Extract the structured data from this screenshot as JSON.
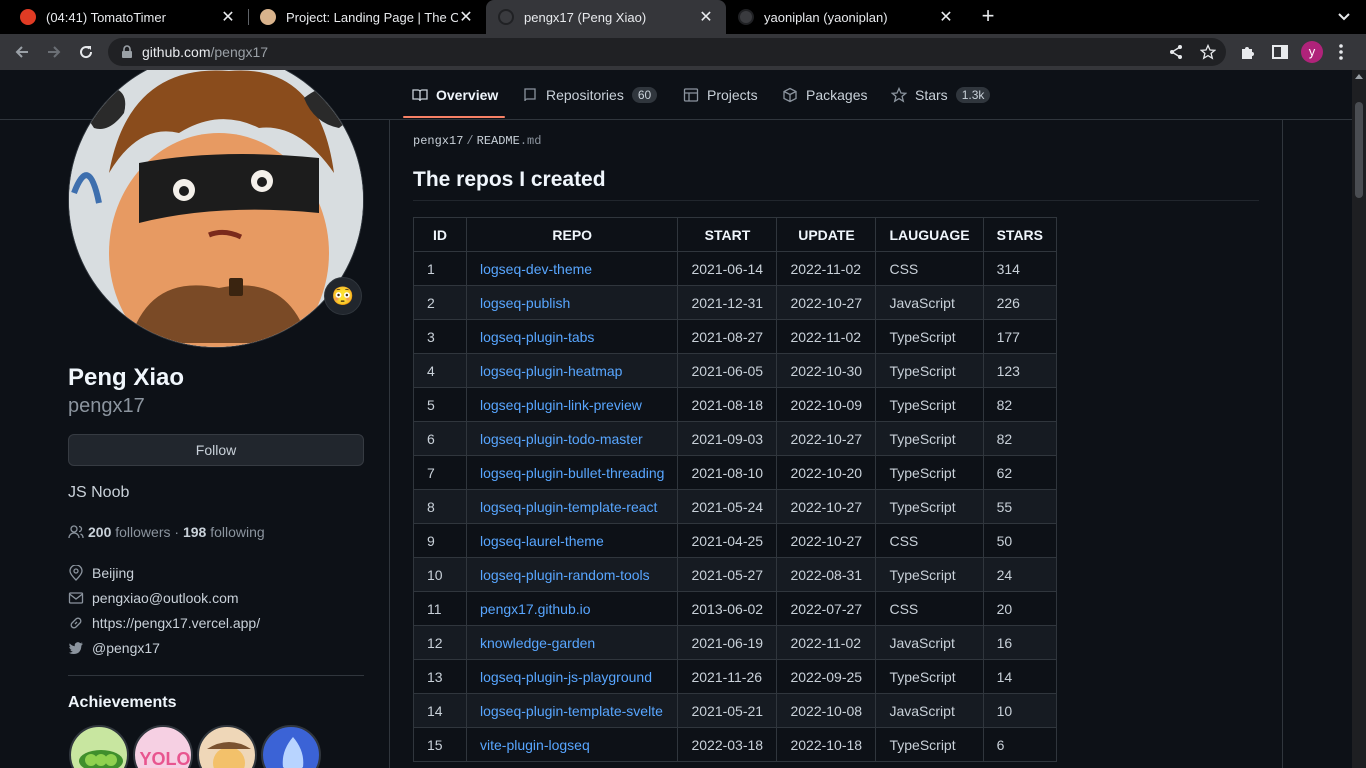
{
  "browser": {
    "tabs": [
      {
        "title": "(04:41) TomatoTimer",
        "favicon": "tomato-icon"
      },
      {
        "title": "Project: Landing Page | The Odin Project",
        "favicon": "odin-icon"
      },
      {
        "title": "pengx17 (Peng Xiao)",
        "favicon": "github-icon"
      },
      {
        "title": "yaoniplan (yaoniplan)",
        "favicon": "github-icon"
      }
    ],
    "url_host": "github.com",
    "url_path": "/pengx17",
    "profile_initial": "y"
  },
  "nav": {
    "overview": "Overview",
    "repositories": "Repositories",
    "repositories_count": "60",
    "projects": "Projects",
    "packages": "Packages",
    "stars": "Stars",
    "stars_count": "1.3k"
  },
  "profile": {
    "status_emoji": "😳",
    "name": "Peng Xiao",
    "login": "pengx17",
    "follow_label": "Follow",
    "bio": "JS Noob",
    "followers_count": "200",
    "followers_label": "followers",
    "separator": "·",
    "following_count": "198",
    "following_label": "following",
    "location": "Beijing",
    "email": "pengxiao@outlook.com",
    "website": "https://pengx17.vercel.app/",
    "twitter": "@pengx17",
    "achievements_title": "Achievements"
  },
  "readme": {
    "crumb_user": "pengx17",
    "crumb_sep": "/",
    "crumb_file": "README",
    "crumb_ext": ".md",
    "heading": "The repos I created",
    "columns": [
      "ID",
      "REPO",
      "START",
      "UPDATE",
      "LAUGUAGE",
      "STARS"
    ],
    "rows": [
      [
        "1",
        "logseq-dev-theme",
        "2021-06-14",
        "2022-11-02",
        "CSS",
        "314"
      ],
      [
        "2",
        "logseq-publish",
        "2021-12-31",
        "2022-10-27",
        "JavaScript",
        "226"
      ],
      [
        "3",
        "logseq-plugin-tabs",
        "2021-08-27",
        "2022-11-02",
        "TypeScript",
        "177"
      ],
      [
        "4",
        "logseq-plugin-heatmap",
        "2021-06-05",
        "2022-10-30",
        "TypeScript",
        "123"
      ],
      [
        "5",
        "logseq-plugin-link-preview",
        "2021-08-18",
        "2022-10-09",
        "TypeScript",
        "82"
      ],
      [
        "6",
        "logseq-plugin-todo-master",
        "2021-09-03",
        "2022-10-27",
        "TypeScript",
        "82"
      ],
      [
        "7",
        "logseq-plugin-bullet-threading",
        "2021-08-10",
        "2022-10-20",
        "TypeScript",
        "62"
      ],
      [
        "8",
        "logseq-plugin-template-react",
        "2021-05-24",
        "2022-10-27",
        "TypeScript",
        "55"
      ],
      [
        "9",
        "logseq-laurel-theme",
        "2021-04-25",
        "2022-10-27",
        "CSS",
        "50"
      ],
      [
        "10",
        "logseq-plugin-random-tools",
        "2021-05-27",
        "2022-08-31",
        "TypeScript",
        "24"
      ],
      [
        "11",
        "pengx17.github.io",
        "2013-06-02",
        "2022-07-27",
        "CSS",
        "20"
      ],
      [
        "12",
        "knowledge-garden",
        "2021-06-19",
        "2022-11-02",
        "JavaScript",
        "16"
      ],
      [
        "13",
        "logseq-plugin-js-playground",
        "2021-11-26",
        "2022-09-25",
        "TypeScript",
        "14"
      ],
      [
        "14",
        "logseq-plugin-template-svelte",
        "2021-05-21",
        "2022-10-08",
        "JavaScript",
        "10"
      ],
      [
        "15",
        "vite-plugin-logseq",
        "2022-03-18",
        "2022-10-18",
        "TypeScript",
        "6"
      ]
    ]
  }
}
